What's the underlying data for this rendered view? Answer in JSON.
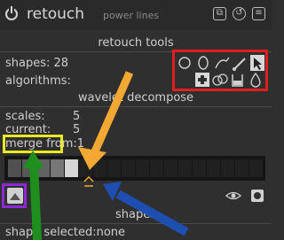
{
  "header": {
    "title": "retouch",
    "subtitle": "power lines",
    "buttons": [
      "instances-icon",
      "reset-icon",
      "presets-icon"
    ]
  },
  "retouch_tools": {
    "section_title": "retouch tools",
    "shapes_label": "shapes: 28",
    "algorithms_label": "algorithms:",
    "shape_tools": [
      "circle-icon",
      "ellipse-icon",
      "path-icon",
      "brush-icon",
      "show-shapes-icon"
    ],
    "algorithm_tools": [
      "heal-icon",
      "clone-icon",
      "fill-icon",
      "blur-icon"
    ]
  },
  "wavelet": {
    "section_title": "wavelet decompose",
    "scales_label": "scales:",
    "scales_value": "5",
    "current_label": "current:",
    "current_value": "5",
    "merge_label": "merge from:1",
    "cells_total": 18,
    "cells_active": 5
  },
  "shapes": {
    "section_title": "shapes",
    "selected_label": "shape selected:none"
  },
  "annotation_colors": {
    "red": "#e0201e",
    "yellow": "#eaea20",
    "purple": "#8c2bd6",
    "orange": "#f2a833",
    "green": "#1e8f1e",
    "blue": "#1e4fb0"
  }
}
